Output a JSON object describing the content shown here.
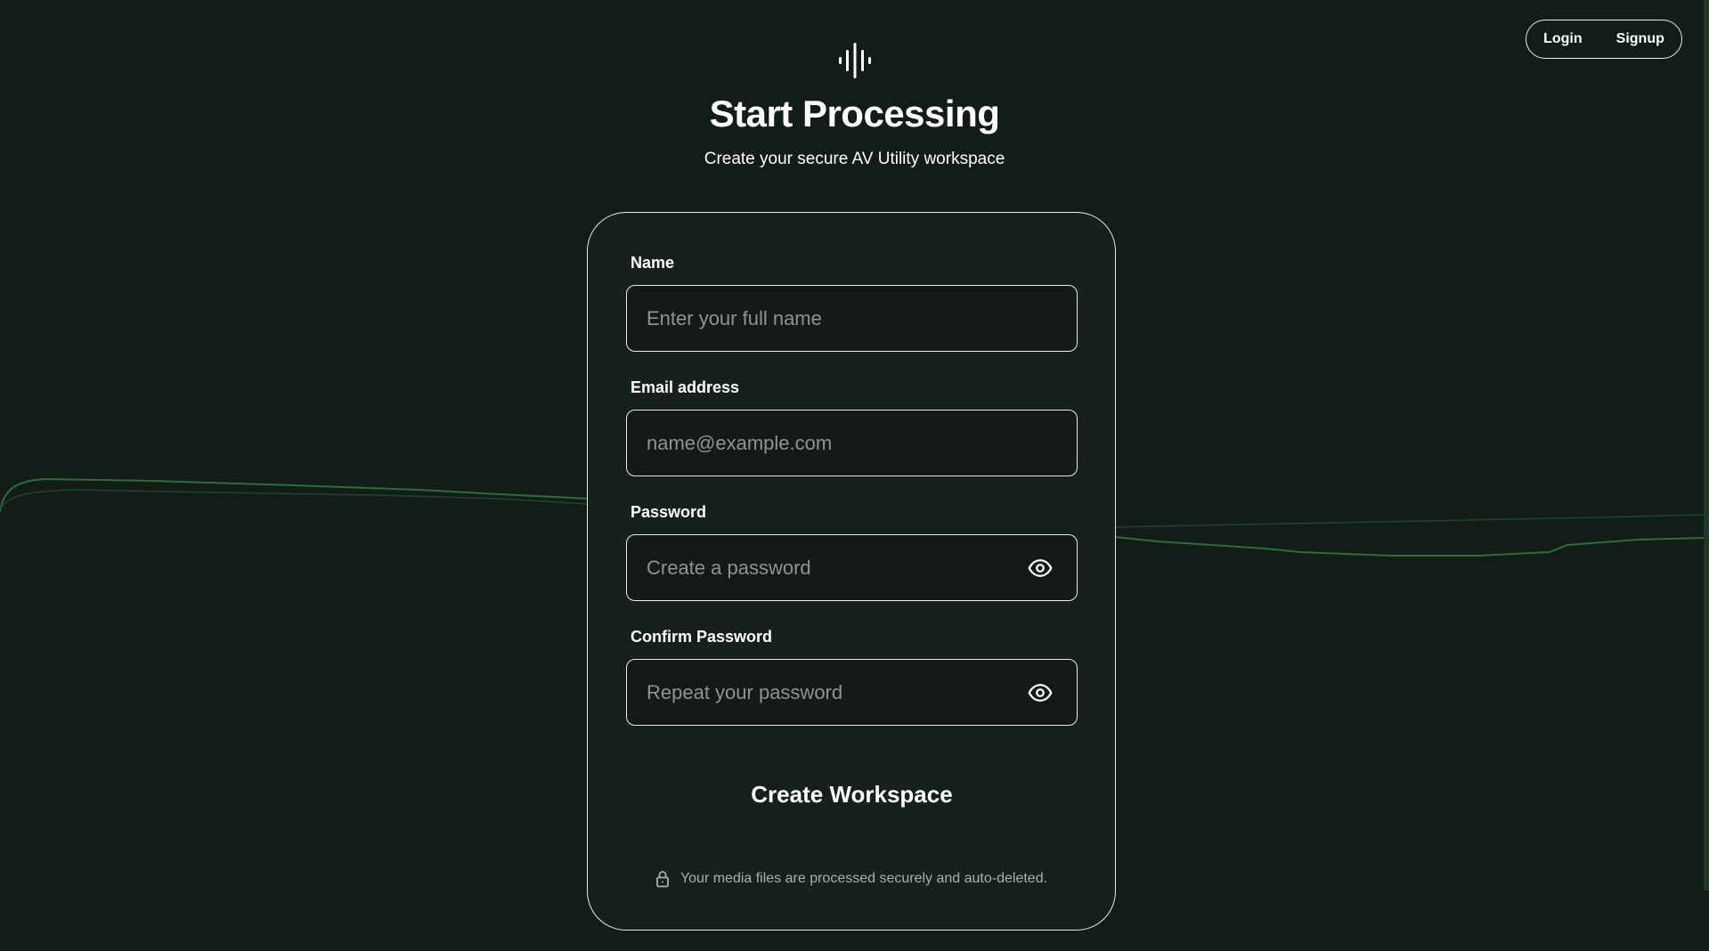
{
  "nav": {
    "login_label": "Login",
    "signup_label": "Signup"
  },
  "brand": {
    "logo_icon": "sound-wave-icon"
  },
  "header": {
    "title": "Start Processing",
    "subtitle": "Create your secure AV Utility workspace"
  },
  "form": {
    "name": {
      "label": "Name",
      "placeholder": "Enter your full name",
      "value": ""
    },
    "email": {
      "label": "Email address",
      "placeholder": "name@example.com",
      "value": ""
    },
    "password": {
      "label": "Password",
      "placeholder": "Create a password",
      "value": "",
      "toggle_icon": "eye-icon"
    },
    "confirm_password": {
      "label": "Confirm Password",
      "placeholder": "Repeat your password",
      "value": "",
      "toggle_icon": "eye-icon"
    },
    "submit_label": "Create Workspace",
    "security_note": "Your media files are processed securely and auto-deleted.",
    "security_icon": "lock-icon"
  },
  "colors": {
    "background": "#131c17",
    "card": "#18201c",
    "border": "#e8ece9",
    "waveform_line": "#2f7d45",
    "muted_text": "#a9b0ab"
  }
}
